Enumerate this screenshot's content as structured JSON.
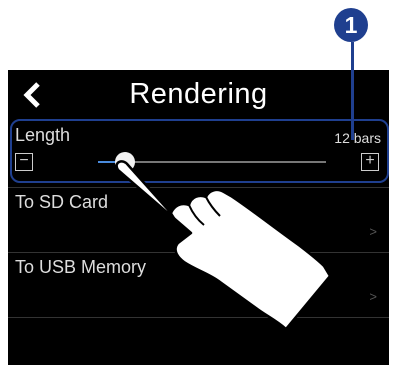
{
  "header": {
    "title": "Rendering"
  },
  "length": {
    "label": "Length",
    "value": "12 bars",
    "minus": "−",
    "plus": "+",
    "slider_fraction": 0.12
  },
  "items": [
    {
      "label": "To SD Card",
      "chevron": ">"
    },
    {
      "label": "To USB Memory",
      "chevron": ">"
    }
  ],
  "callout": {
    "number": "1"
  },
  "colors": {
    "accent": "#4a8bdc",
    "callout": "#1f3f8f",
    "background": "#000000"
  }
}
